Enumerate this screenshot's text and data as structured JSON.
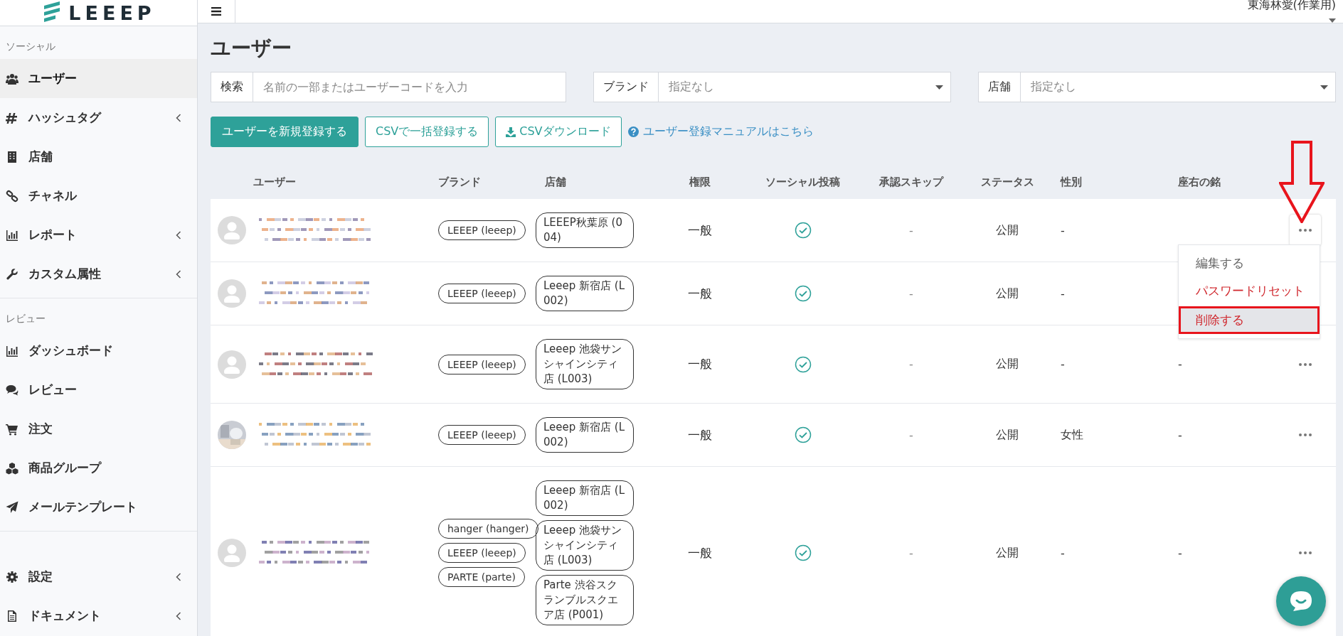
{
  "header": {
    "logo": "LEEEP",
    "user": "東海林愛(作業用)"
  },
  "sidebar": [
    {
      "label": "ソーシャル",
      "items": [
        {
          "label": "ユーザー",
          "selected": true,
          "submenu": false
        },
        {
          "label": "ハッシュタグ",
          "selected": false,
          "submenu": true
        },
        {
          "label": "店舗",
          "selected": false,
          "submenu": false
        },
        {
          "label": "チャネル",
          "selected": false,
          "submenu": false
        },
        {
          "label": "レポート",
          "selected": false,
          "submenu": true
        },
        {
          "label": "カスタム属性",
          "selected": false,
          "submenu": true
        }
      ]
    },
    {
      "label": "レビュー",
      "items": [
        {
          "label": "ダッシュボード",
          "selected": false,
          "submenu": false
        },
        {
          "label": "レビュー",
          "selected": false,
          "submenu": false
        },
        {
          "label": "注文",
          "selected": false,
          "submenu": false
        },
        {
          "label": "商品グループ",
          "selected": false,
          "submenu": false
        },
        {
          "label": "メールテンプレート",
          "selected": false,
          "submenu": false
        }
      ]
    },
    {
      "items": [
        {
          "label": "設定",
          "selected": false,
          "submenu": true
        },
        {
          "label": "ドキュメント",
          "selected": false,
          "submenu": true
        }
      ]
    }
  ],
  "page_title": "ユーザー",
  "filters": [
    {
      "label": "検索",
      "kind": "text",
      "placeholder": "名前の一部またはユーザーコードを入力"
    },
    {
      "label": "ブランド",
      "kind": "select",
      "placeholder": "指定なし"
    },
    {
      "label": "店舗",
      "kind": "select",
      "placeholder": "指定なし"
    }
  ],
  "actions": [
    {
      "label": "ユーザーを新規登録する",
      "kind": "primary"
    },
    {
      "label": "CSVで一括登録する",
      "kind": "outline"
    },
    {
      "label": "CSVダウンロード",
      "kind": "download"
    },
    {
      "label": "ユーザー登録マニュアルはこちら",
      "kind": "help-link"
    }
  ],
  "table": {
    "columns": [
      "ユーザー",
      "ブランド",
      "店舗",
      "権限",
      "ソーシャル投稿",
      "承認スキップ",
      "ステータス",
      "性別",
      "座右の銘"
    ],
    "rows": [
      {
        "photo_avatar": false,
        "brands": [
          "LEEEP (leeep)"
        ],
        "stores": [
          "LEEEP秋葉原 (004)"
        ],
        "role": "一般",
        "social_post": true,
        "approval_skip": "-",
        "status": "公開",
        "gender": "-",
        "more_button": true,
        "menu_open": true,
        "arrow": true
      },
      {
        "photo_avatar": false,
        "brands": [
          "LEEEP (leeep)"
        ],
        "stores": [
          "Leeep 新宿店 (L002)"
        ],
        "role": "一般",
        "social_post": true,
        "approval_skip": "-",
        "status": "公開",
        "gender": "-",
        "more_button": false,
        "menu_open": false,
        "arrow": false
      },
      {
        "photo_avatar": false,
        "brands": [
          "LEEEP (leeep)"
        ],
        "stores": [
          "Leeep 池袋サンシャインシティ店 (L003)"
        ],
        "role": "一般",
        "social_post": true,
        "approval_skip": "-",
        "status": "公開",
        "gender": "-",
        "motto": "-",
        "more_button": true,
        "menu_open": false,
        "arrow": false
      },
      {
        "photo_avatar": true,
        "brands": [
          "LEEEP (leeep)"
        ],
        "stores": [
          "Leeep 新宿店 (L002)"
        ],
        "role": "一般",
        "social_post": true,
        "approval_skip": "-",
        "status": "公開",
        "gender": "女性",
        "motto": "-",
        "more_button": true,
        "menu_open": false,
        "arrow": false
      },
      {
        "photo_avatar": false,
        "brands": [
          "hanger (hanger)",
          "LEEEP (leeep)",
          "PARTE (parte)"
        ],
        "stores": [
          "Leeep 新宿店 (L002)",
          "Leeep 池袋サンシャインシティ店 (L003)",
          "Parte 渋谷スクランブルスクエア店 (P001)"
        ],
        "role": "一般",
        "social_post": true,
        "approval_skip": "-",
        "status": "公開",
        "gender": "-",
        "motto": "-",
        "more_button": true,
        "menu_open": false,
        "arrow": false
      }
    ]
  },
  "row_menu": [
    {
      "label": "編集する",
      "kind": "normal",
      "highlighted": false,
      "framed": false
    },
    {
      "label": "パスワードリセット",
      "kind": "danger",
      "highlighted": false,
      "framed": false
    },
    {
      "label": "削除する",
      "kind": "danger",
      "highlighted": true,
      "framed": true
    }
  ]
}
